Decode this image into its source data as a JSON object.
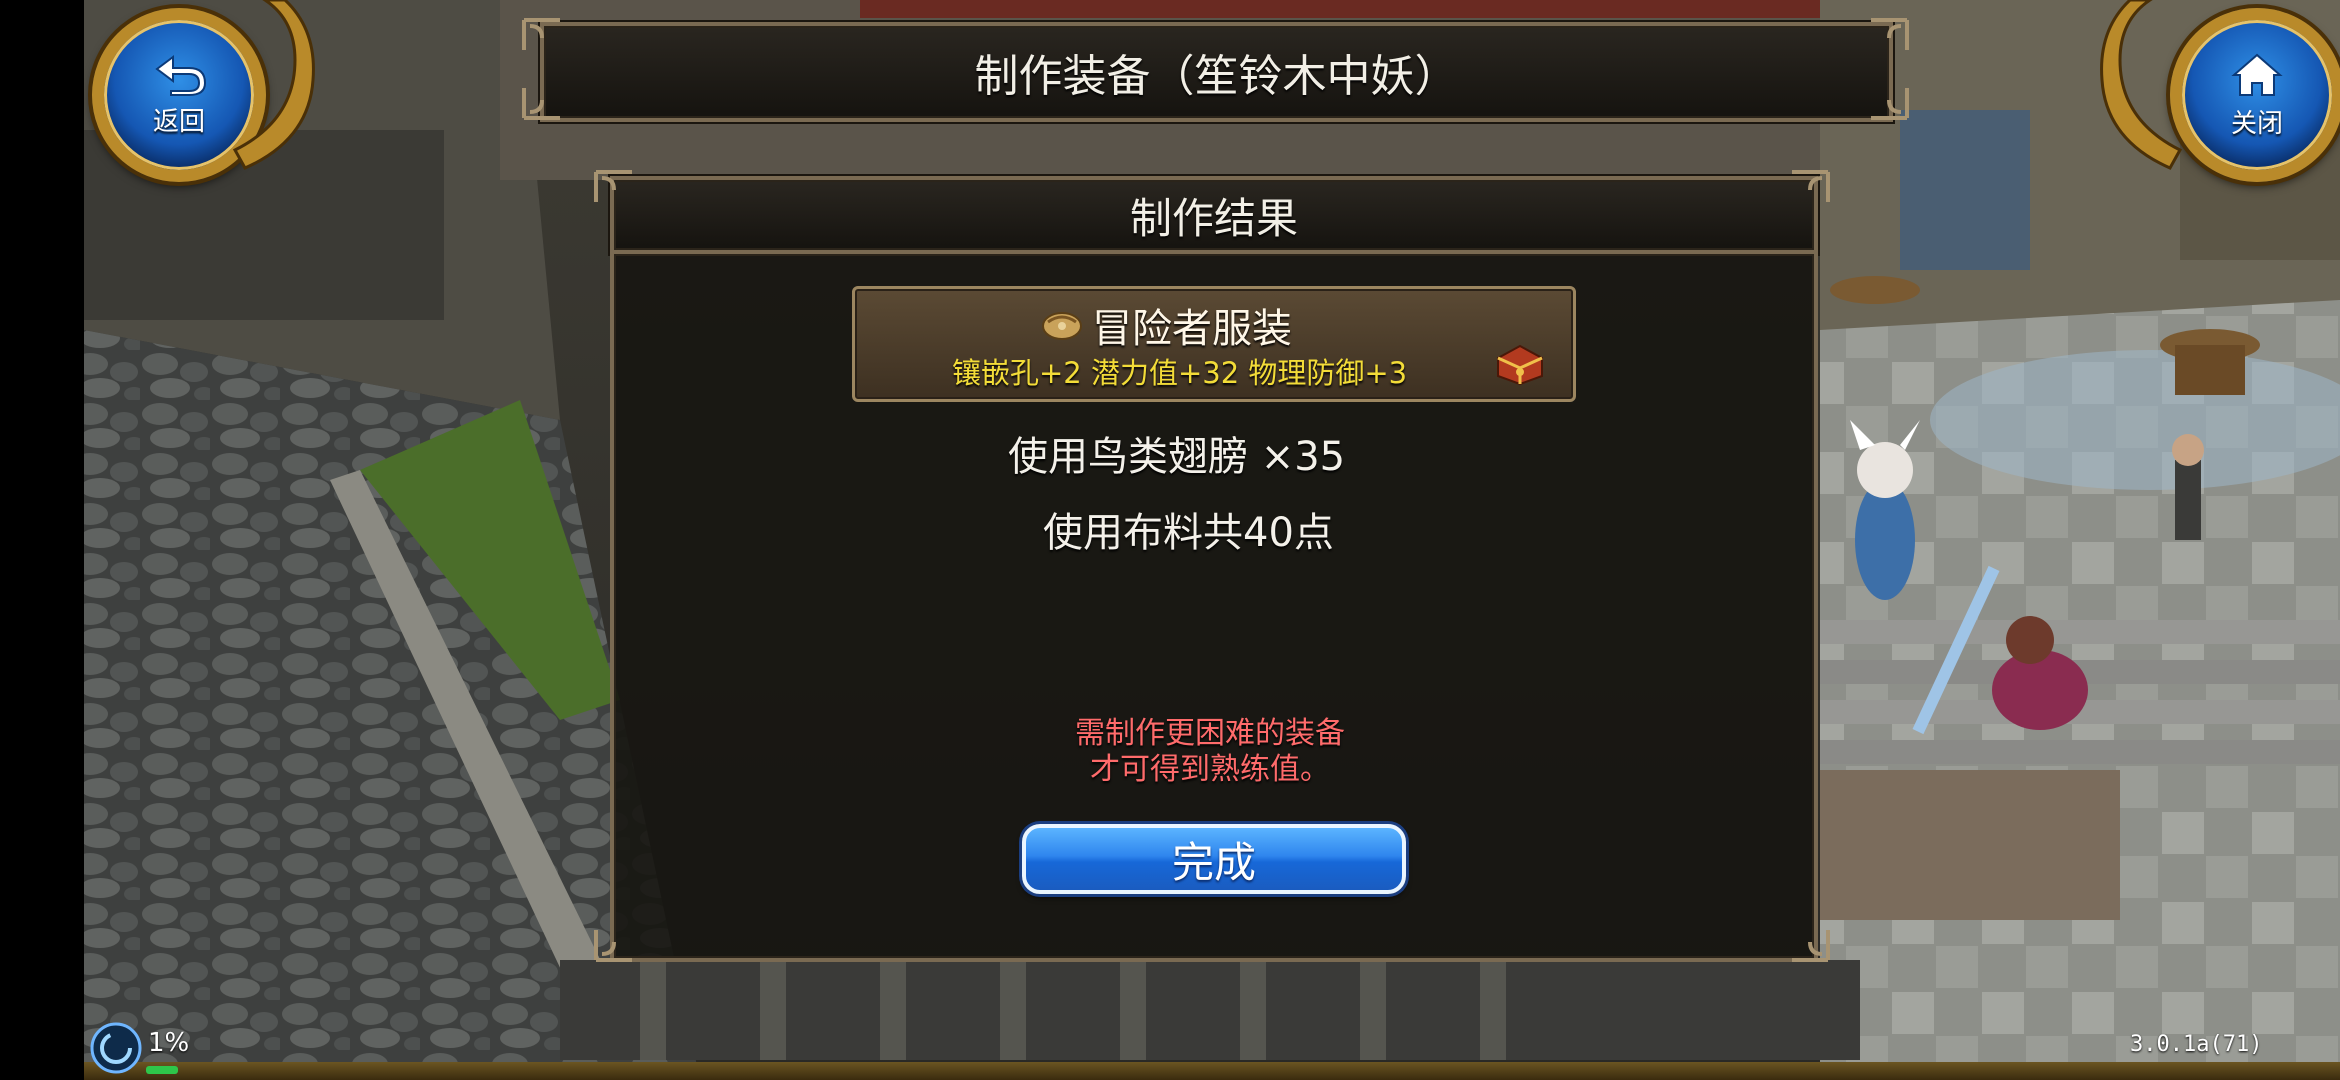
{
  "header": {
    "title": "制作装备（笙铃木中妖）",
    "back_label": "返回",
    "close_label": "关闭"
  },
  "result_panel": {
    "title": "制作结果",
    "item": {
      "name": "冒险者服装",
      "stats": "镶嵌孔+2 潜力值+32 物理防御+3"
    },
    "usage_lines": [
      "使用鸟类翅膀 ×35",
      "使用布料共40点"
    ],
    "warning_lines": [
      "需制作更困难的装备",
      "才可得到熟练值。"
    ],
    "done_label": "完成"
  },
  "status": {
    "progress_text": "1%",
    "version": "3.0.1a(71)"
  },
  "colors": {
    "warning": "#ff6b6b",
    "stats": "#f3dc38",
    "button_blue": "#1768d8"
  },
  "icons": [
    "back-arrow-icon",
    "home-icon",
    "item-bundle-icon",
    "treasure-chest-icon",
    "loading-orb-icon"
  ]
}
